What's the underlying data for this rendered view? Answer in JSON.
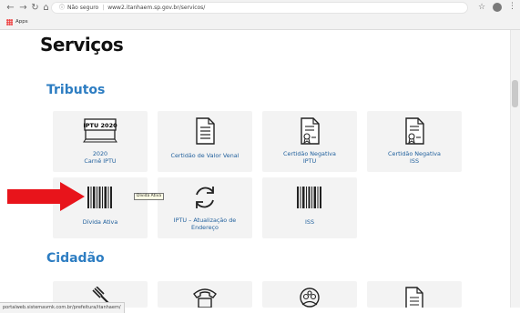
{
  "browser": {
    "url_security": "Não seguro",
    "url": "www2.itanhaem.sp.gov.br/servicos/",
    "bookmarks_label": "Apps"
  },
  "page": {
    "title": "Serviços",
    "sections": {
      "tributos": "Tributos",
      "cidadao": "Cidadão"
    }
  },
  "tributos_cards": [
    {
      "icon": "iptu-2020-icon",
      "icon_text": "IPTU 2020",
      "lines": [
        "2020",
        "Carnê IPTU"
      ]
    },
    {
      "icon": "document-icon",
      "lines": [
        "Certidão de Valor Venal"
      ]
    },
    {
      "icon": "certificate-icon",
      "lines": [
        "Certidão Negativa",
        "IPTU"
      ]
    },
    {
      "icon": "certificate-icon",
      "lines": [
        "Certidão Negativa",
        "ISS"
      ]
    },
    {
      "icon": "barcode-icon",
      "lines": [
        "Dívida Ativa"
      ]
    },
    {
      "icon": "refresh-icon",
      "lines": [
        "IPTU – Atualização de",
        "Endereço"
      ]
    },
    {
      "icon": "barcode-icon",
      "lines": [
        "ISS"
      ]
    }
  ],
  "cidadao_cards": [
    {
      "icon": "gavel-icon"
    },
    {
      "icon": "telephone-icon"
    },
    {
      "icon": "people-icon"
    },
    {
      "icon": "document-icon"
    }
  ],
  "tooltip": "Dívida Ativa",
  "status_url": "portalweb.sistemavmk.com.br/prefeitura/itanhaem/"
}
